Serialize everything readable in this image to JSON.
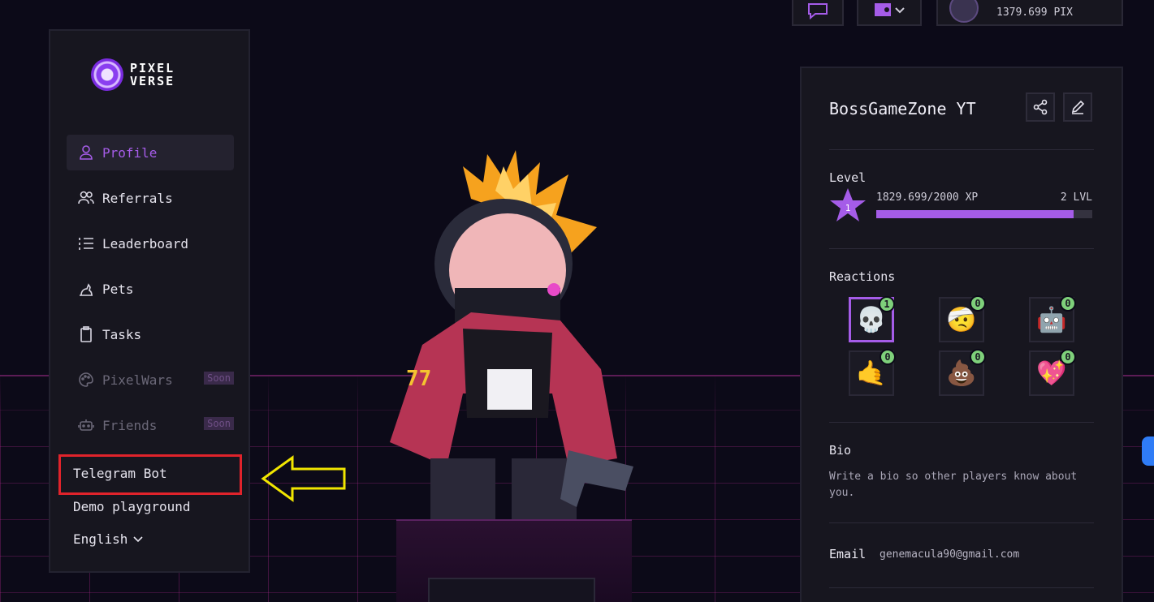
{
  "logo": {
    "line1": "PIXEL",
    "line2": "VERSE"
  },
  "nav": {
    "profile": "Profile",
    "referrals": "Referrals",
    "leaderboard": "Leaderboard",
    "pets": "Pets",
    "tasks": "Tasks",
    "pixelwars": "PixelWars",
    "friends": "Friends",
    "soon": "Soon",
    "telegram_bot": "Telegram Bot",
    "demo_playground": "Demo playground",
    "language": "English"
  },
  "topbar": {
    "balance": "1379.699 PIX"
  },
  "profile": {
    "username": "BossGameZone YT",
    "level_label": "Level",
    "level_badge": "1",
    "xp": "1829.699/2000 XP",
    "next_level": "2 LVL",
    "xp_progress": 0.915,
    "reactions_label": "Reactions",
    "reactions": [
      {
        "icon": "skull-icon",
        "glyph": "💀",
        "count": "1",
        "selected": true
      },
      {
        "icon": "bruised-face-icon",
        "glyph": "🤕",
        "count": "0",
        "selected": false
      },
      {
        "icon": "robot-face-icon",
        "glyph": "🤖",
        "count": "0",
        "selected": false
      },
      {
        "icon": "hand-icon",
        "glyph": "🤙",
        "count": "0",
        "selected": false
      },
      {
        "icon": "poop-icon",
        "glyph": "💩",
        "count": "0",
        "selected": false
      },
      {
        "icon": "rainbow-heart-icon",
        "glyph": "💖",
        "count": "0",
        "selected": false
      }
    ],
    "bio_label": "Bio",
    "bio_text": "Write a bio so other players know about you.",
    "email_label": "Email",
    "email_value": "genemacula90@gmail.com"
  },
  "colors": {
    "accent": "#a55ce8",
    "highlight": "#e0232b",
    "arrow": "#f2e600"
  }
}
